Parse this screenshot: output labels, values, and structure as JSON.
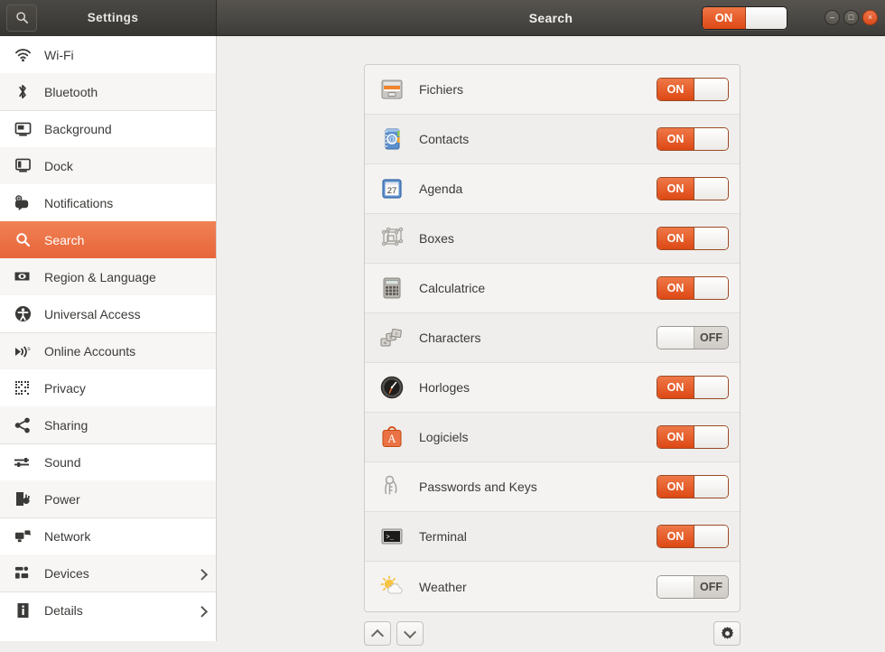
{
  "titlebar": {
    "search_icon": "search-icon",
    "sidebar_title": "Settings",
    "title": "Search",
    "master_toggle": {
      "state": "ON",
      "label": "ON"
    },
    "window_controls": [
      {
        "name": "minimize",
        "glyph": "–"
      },
      {
        "name": "maximize",
        "glyph": "□"
      },
      {
        "name": "close",
        "glyph": "×"
      }
    ]
  },
  "sidebar": {
    "items": [
      {
        "label": "Wi-Fi",
        "icon": "wifi-icon",
        "chevron": false
      },
      {
        "label": "Bluetooth",
        "icon": "bluetooth-icon",
        "chevron": false
      },
      {
        "label": "Background",
        "icon": "background-icon",
        "chevron": false
      },
      {
        "label": "Dock",
        "icon": "dock-icon",
        "chevron": false
      },
      {
        "label": "Notifications",
        "icon": "notifications-icon",
        "chevron": false
      },
      {
        "label": "Search",
        "icon": "search-icon",
        "chevron": false,
        "active": true
      },
      {
        "label": "Region & Language",
        "icon": "region-language-icon",
        "chevron": false
      },
      {
        "label": "Universal Access",
        "icon": "universal-access-icon",
        "chevron": false
      },
      {
        "label": "Online Accounts",
        "icon": "online-accounts-icon",
        "chevron": false
      },
      {
        "label": "Privacy",
        "icon": "privacy-icon",
        "chevron": false
      },
      {
        "label": "Sharing",
        "icon": "sharing-icon",
        "chevron": false
      },
      {
        "label": "Sound",
        "icon": "sound-icon",
        "chevron": false
      },
      {
        "label": "Power",
        "icon": "power-icon",
        "chevron": false
      },
      {
        "label": "Network",
        "icon": "network-icon",
        "chevron": false
      },
      {
        "label": "Devices",
        "icon": "devices-icon",
        "chevron": true
      },
      {
        "label": "Details",
        "icon": "details-icon",
        "chevron": true
      }
    ]
  },
  "main": {
    "rows": [
      {
        "label": "Fichiers",
        "icon": "files-icon",
        "state": "ON",
        "on_label": "ON"
      },
      {
        "label": "Contacts",
        "icon": "contacts-icon",
        "state": "ON",
        "on_label": "ON"
      },
      {
        "label": "Agenda",
        "icon": "calendar-icon",
        "icon_text": "27",
        "state": "ON",
        "on_label": "ON"
      },
      {
        "label": "Boxes",
        "icon": "boxes-icon",
        "state": "ON",
        "on_label": "ON"
      },
      {
        "label": "Calculatrice",
        "icon": "calculator-icon",
        "state": "ON",
        "on_label": "ON"
      },
      {
        "label": "Characters",
        "icon": "characters-icon",
        "state": "OFF",
        "off_label": "OFF"
      },
      {
        "label": "Horloges",
        "icon": "clocks-icon",
        "state": "ON",
        "on_label": "ON"
      },
      {
        "label": "Logiciels",
        "icon": "software-icon",
        "icon_text": "A",
        "state": "ON",
        "on_label": "ON"
      },
      {
        "label": "Passwords and Keys",
        "icon": "passwords-keys-icon",
        "state": "ON",
        "on_label": "ON"
      },
      {
        "label": "Terminal",
        "icon": "terminal-icon",
        "state": "ON",
        "on_label": "ON"
      },
      {
        "label": "Weather",
        "icon": "weather-icon",
        "state": "OFF",
        "off_label": "OFF"
      }
    ],
    "toolbar": {
      "move_up": "move-up-button",
      "move_down": "move-down-button",
      "settings": "search-settings-gear-button"
    }
  },
  "colors": {
    "accent_orange": "#dd4814",
    "selection_orange": "#e7653a",
    "titlebar_dark": "#413f3b",
    "content_bg": "#f0efee",
    "text": "#3a3a38"
  }
}
